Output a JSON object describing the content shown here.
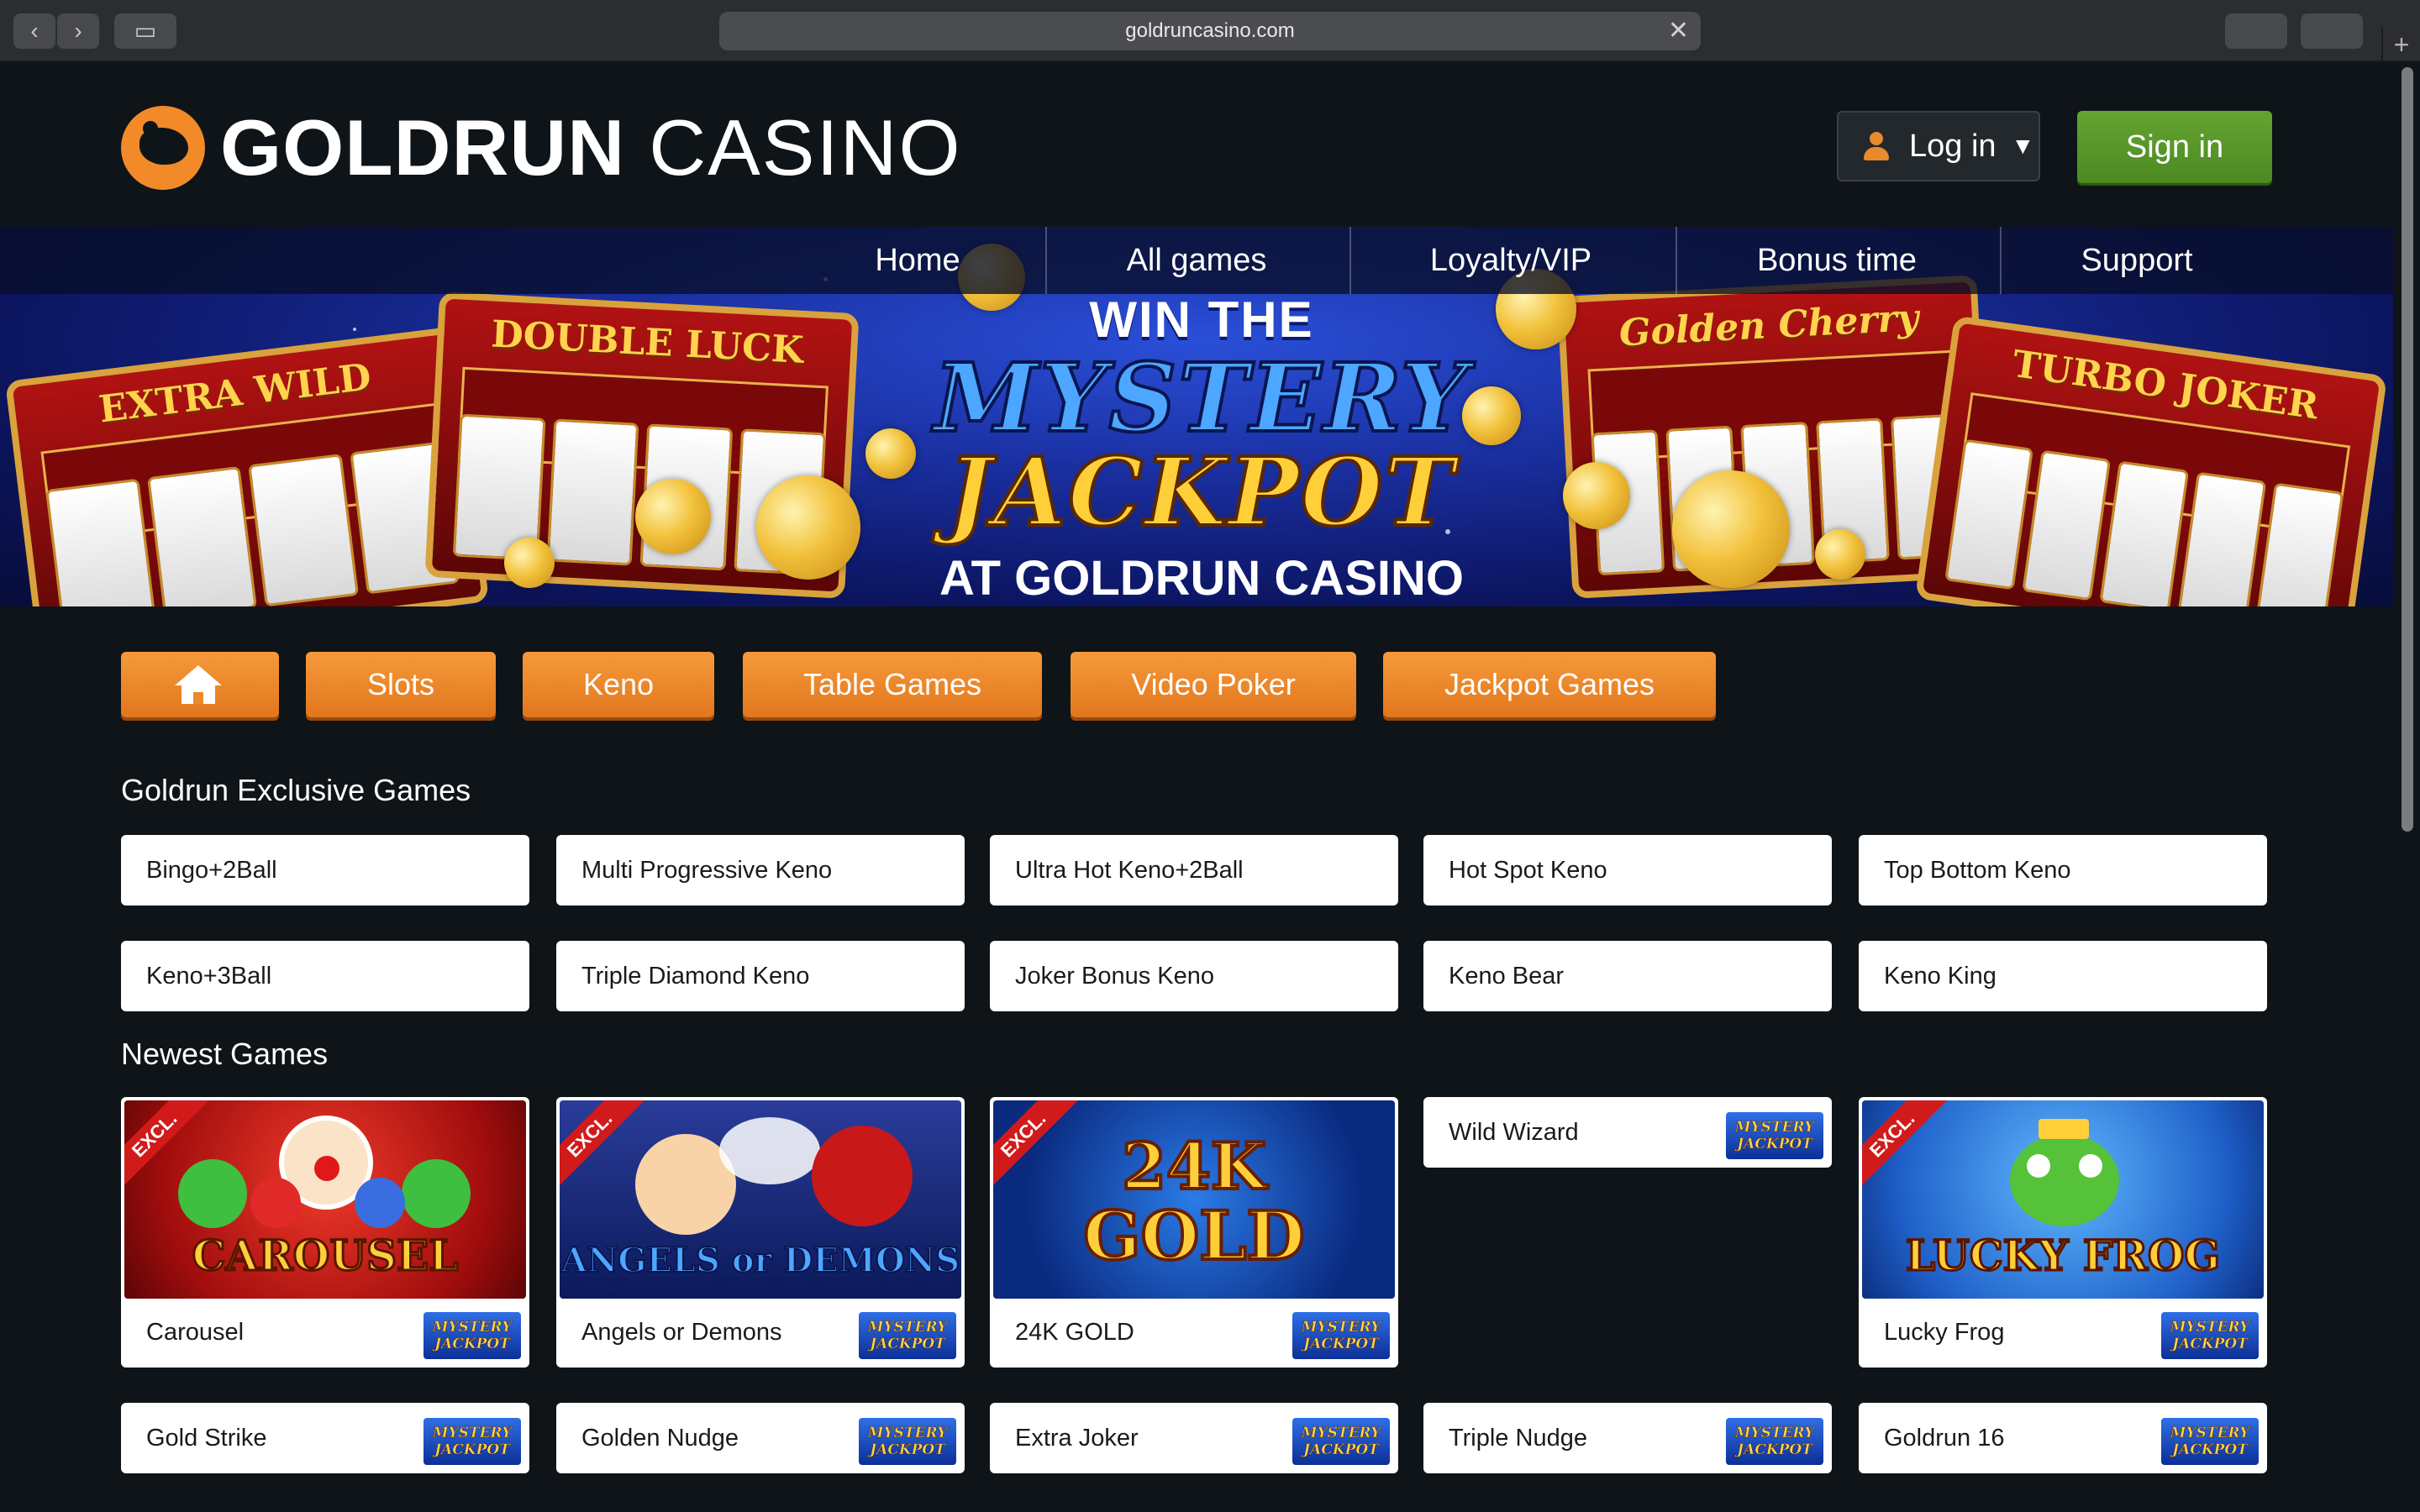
{
  "browser": {
    "url": "goldruncasino.com"
  },
  "header": {
    "logo_bold": "GOLDRUN",
    "logo_light": "CASINO",
    "login_label": "Log in",
    "signin_label": "Sign in"
  },
  "nav": {
    "items": [
      "Home",
      "All games",
      "Loyalty/VIP",
      "Bonus time",
      "Support"
    ]
  },
  "banner": {
    "line1": "WIN THE",
    "line2": "MYSTERY",
    "line3": "JACKPOT",
    "line4": "AT GOLDRUN CASINO",
    "machine_left1": "EXTRA WILD",
    "machine_left2": "DOUBLE LUCK",
    "machine_right1": "Golden Cherry",
    "machine_right2": "TURBO JOKER"
  },
  "categories": [
    "Slots",
    "Keno",
    "Table Games",
    "Video Poker",
    "Jackpot Games"
  ],
  "sections": {
    "exclusive_title": "Goldrun Exclusive Games",
    "newest_title": "Newest Games"
  },
  "exclusive_games": [
    "Bingo+2Ball",
    "Multi Progressive Keno",
    "Ultra Hot Keno+2Ball",
    "Hot Spot Keno",
    "Top Bottom Keno",
    "Keno+3Ball",
    "Triple Diamond Keno",
    "Joker Bonus Keno",
    "Keno Bear",
    "Keno King"
  ],
  "newest_games": {
    "row1": [
      "Carousel",
      "Angels or Demons",
      "24K GOLD",
      "Wild Wizard",
      "Lucky Frog"
    ],
    "row2": [
      "Gold Strike",
      "Golden Nudge",
      "Extra Joker",
      "Triple Nudge",
      "Goldrun 16"
    ]
  },
  "thumbs": {
    "excl": "EXCL.",
    "carousel": "CAROUSEL",
    "angels": "ANGELS or DEMONS",
    "gold_a": "24K",
    "gold_b": "GOLD",
    "frog": "LUCKY FROG"
  },
  "badge": {
    "line1": "MYSTERY",
    "line2": "JACKPOT"
  }
}
